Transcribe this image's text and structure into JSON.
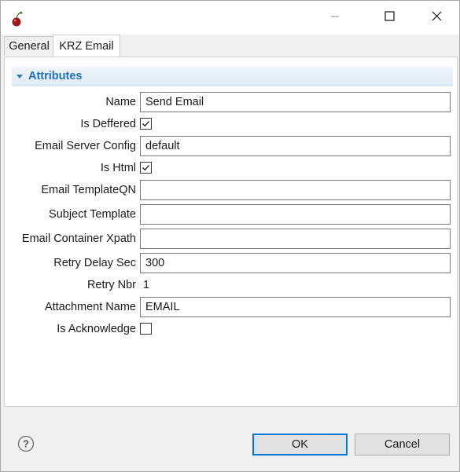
{
  "window": {
    "title": ""
  },
  "tabs": [
    {
      "label": "General"
    },
    {
      "label": "KRZ Email"
    }
  ],
  "section": {
    "title": "Attributes"
  },
  "fields": {
    "name": {
      "label": "Name",
      "value": "Send Email"
    },
    "is_deffered": {
      "label": "Is Deffered",
      "checked": true
    },
    "email_server_config": {
      "label": "Email Server Config",
      "value": "default"
    },
    "is_html": {
      "label": "Is Html",
      "checked": true
    },
    "email_template_qn": {
      "label": "Email TemplateQN",
      "value": ""
    },
    "subject_template": {
      "label": "Subject Template",
      "value": ""
    },
    "email_container_xpath": {
      "label": "Email Container Xpath",
      "value": ""
    },
    "retry_delay_sec": {
      "label": "Retry Delay Sec",
      "value": "300"
    },
    "retry_nbr": {
      "label": "Retry Nbr",
      "value": "1"
    },
    "attachment_name": {
      "label": "Attachment Name",
      "value": "EMAIL"
    },
    "is_acknowledge": {
      "label": "Is Acknowledge",
      "checked": false
    }
  },
  "buttons": {
    "ok": "OK",
    "cancel": "Cancel"
  },
  "icons": {
    "app": "cherry-icon",
    "minimize": "minimize-icon",
    "maximize": "maximize-icon",
    "close": "close-icon",
    "help": "help-icon",
    "section_toggle": "triangle-down-icon"
  },
  "colors": {
    "accent": "#0078d7",
    "section_title": "#1f6fbf"
  }
}
